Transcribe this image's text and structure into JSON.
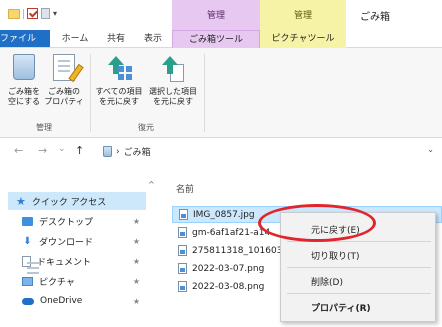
{
  "titlebar": {
    "title": "ごみ箱",
    "context_groups": [
      "管理",
      "管理"
    ]
  },
  "tabs": [
    "ファイル",
    "ホーム",
    "共有",
    "表示",
    "ごみ箱ツール",
    "ピクチャツール"
  ],
  "ribbon": {
    "buttons": [
      {
        "label1": "ごみ箱を",
        "label2": "空にする"
      },
      {
        "label1": "ごみ箱の",
        "label2": "プロパティ"
      },
      {
        "label1": "すべての項目",
        "label2": "を元に戻す"
      },
      {
        "label1": "選択した項目",
        "label2": "を元に戻す"
      }
    ],
    "groups": [
      "管理",
      "復元"
    ]
  },
  "address": {
    "back": "←",
    "forward": "→",
    "recent": "⌄",
    "up": "↑",
    "separator": "›",
    "location": "ごみ箱",
    "dropdown": "⌄"
  },
  "nav_pane": {
    "scroll_up": "^",
    "items": [
      {
        "label": "クイック アクセス",
        "pin": ""
      },
      {
        "label": "デスクトップ",
        "pin": "★"
      },
      {
        "label": "ダウンロード",
        "pin": "★"
      },
      {
        "label": "ドキュメント",
        "pin": "★"
      },
      {
        "label": "ピクチャ",
        "pin": "★"
      },
      {
        "label": "OneDrive",
        "pin": "★"
      }
    ]
  },
  "content": {
    "column_header": "名前",
    "files": [
      "IMG_0857.jpg",
      "gm-6af1af21-a14",
      "275811318_101603",
      "2022-03-07.png",
      "2022-03-08.png"
    ]
  },
  "context_menu": {
    "items": [
      "元に戻す(E)",
      "切り取り(T)",
      "削除(D)",
      "プロパティ(R)"
    ]
  },
  "colors": {
    "file_tab": "#1e6fc5",
    "bin_tools": "#e6c8f0",
    "picture_tools": "#f7f3a6",
    "highlight": "#e0262b",
    "selection": "#cce8ff"
  }
}
